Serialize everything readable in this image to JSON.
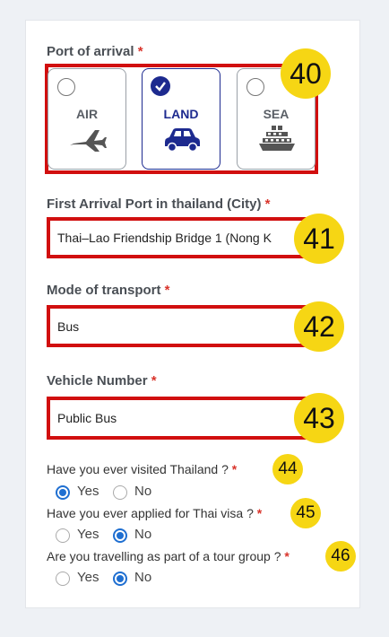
{
  "port_of_arrival": {
    "label": "Port of arrival",
    "required_mark": "*",
    "options": [
      {
        "label": "AIR",
        "icon": "airplane-icon",
        "selected": false
      },
      {
        "label": "LAND",
        "icon": "car-icon",
        "selected": true
      },
      {
        "label": "SEA",
        "icon": "ship-icon",
        "selected": false
      }
    ]
  },
  "first_arrival_port": {
    "label": "First Arrival Port in thailand (City)",
    "required_mark": "*",
    "value": "Thai–Lao Friendship Bridge 1 (Nong K"
  },
  "mode_of_transport": {
    "label": "Mode of transport",
    "required_mark": "*",
    "value": "Bus"
  },
  "vehicle_number": {
    "label": "Vehicle Number",
    "required_mark": "*",
    "value": "Public Bus"
  },
  "questions": [
    {
      "text": "Have you ever visited Thailand ?",
      "required_mark": "*",
      "yes": "Yes",
      "no": "No",
      "answer": "Yes"
    },
    {
      "text": "Have you ever applied for Thai visa ?",
      "required_mark": "*",
      "yes": "Yes",
      "no": "No",
      "answer": "No"
    },
    {
      "text": "Are you travelling as part of a tour group ?",
      "required_mark": "*",
      "yes": "Yes",
      "no": "No",
      "answer": "No"
    }
  ],
  "annotations": {
    "a40": "40",
    "a41": "41",
    "a42": "42",
    "a43": "43",
    "a44": "44",
    "a45": "45",
    "a46": "46"
  },
  "colors": {
    "highlight_box": "#d10f0f",
    "badge": "#f6d614",
    "selected_accent": "#1d2a8f",
    "radio_accent": "#1f6fd1",
    "required": "#d9342b"
  }
}
